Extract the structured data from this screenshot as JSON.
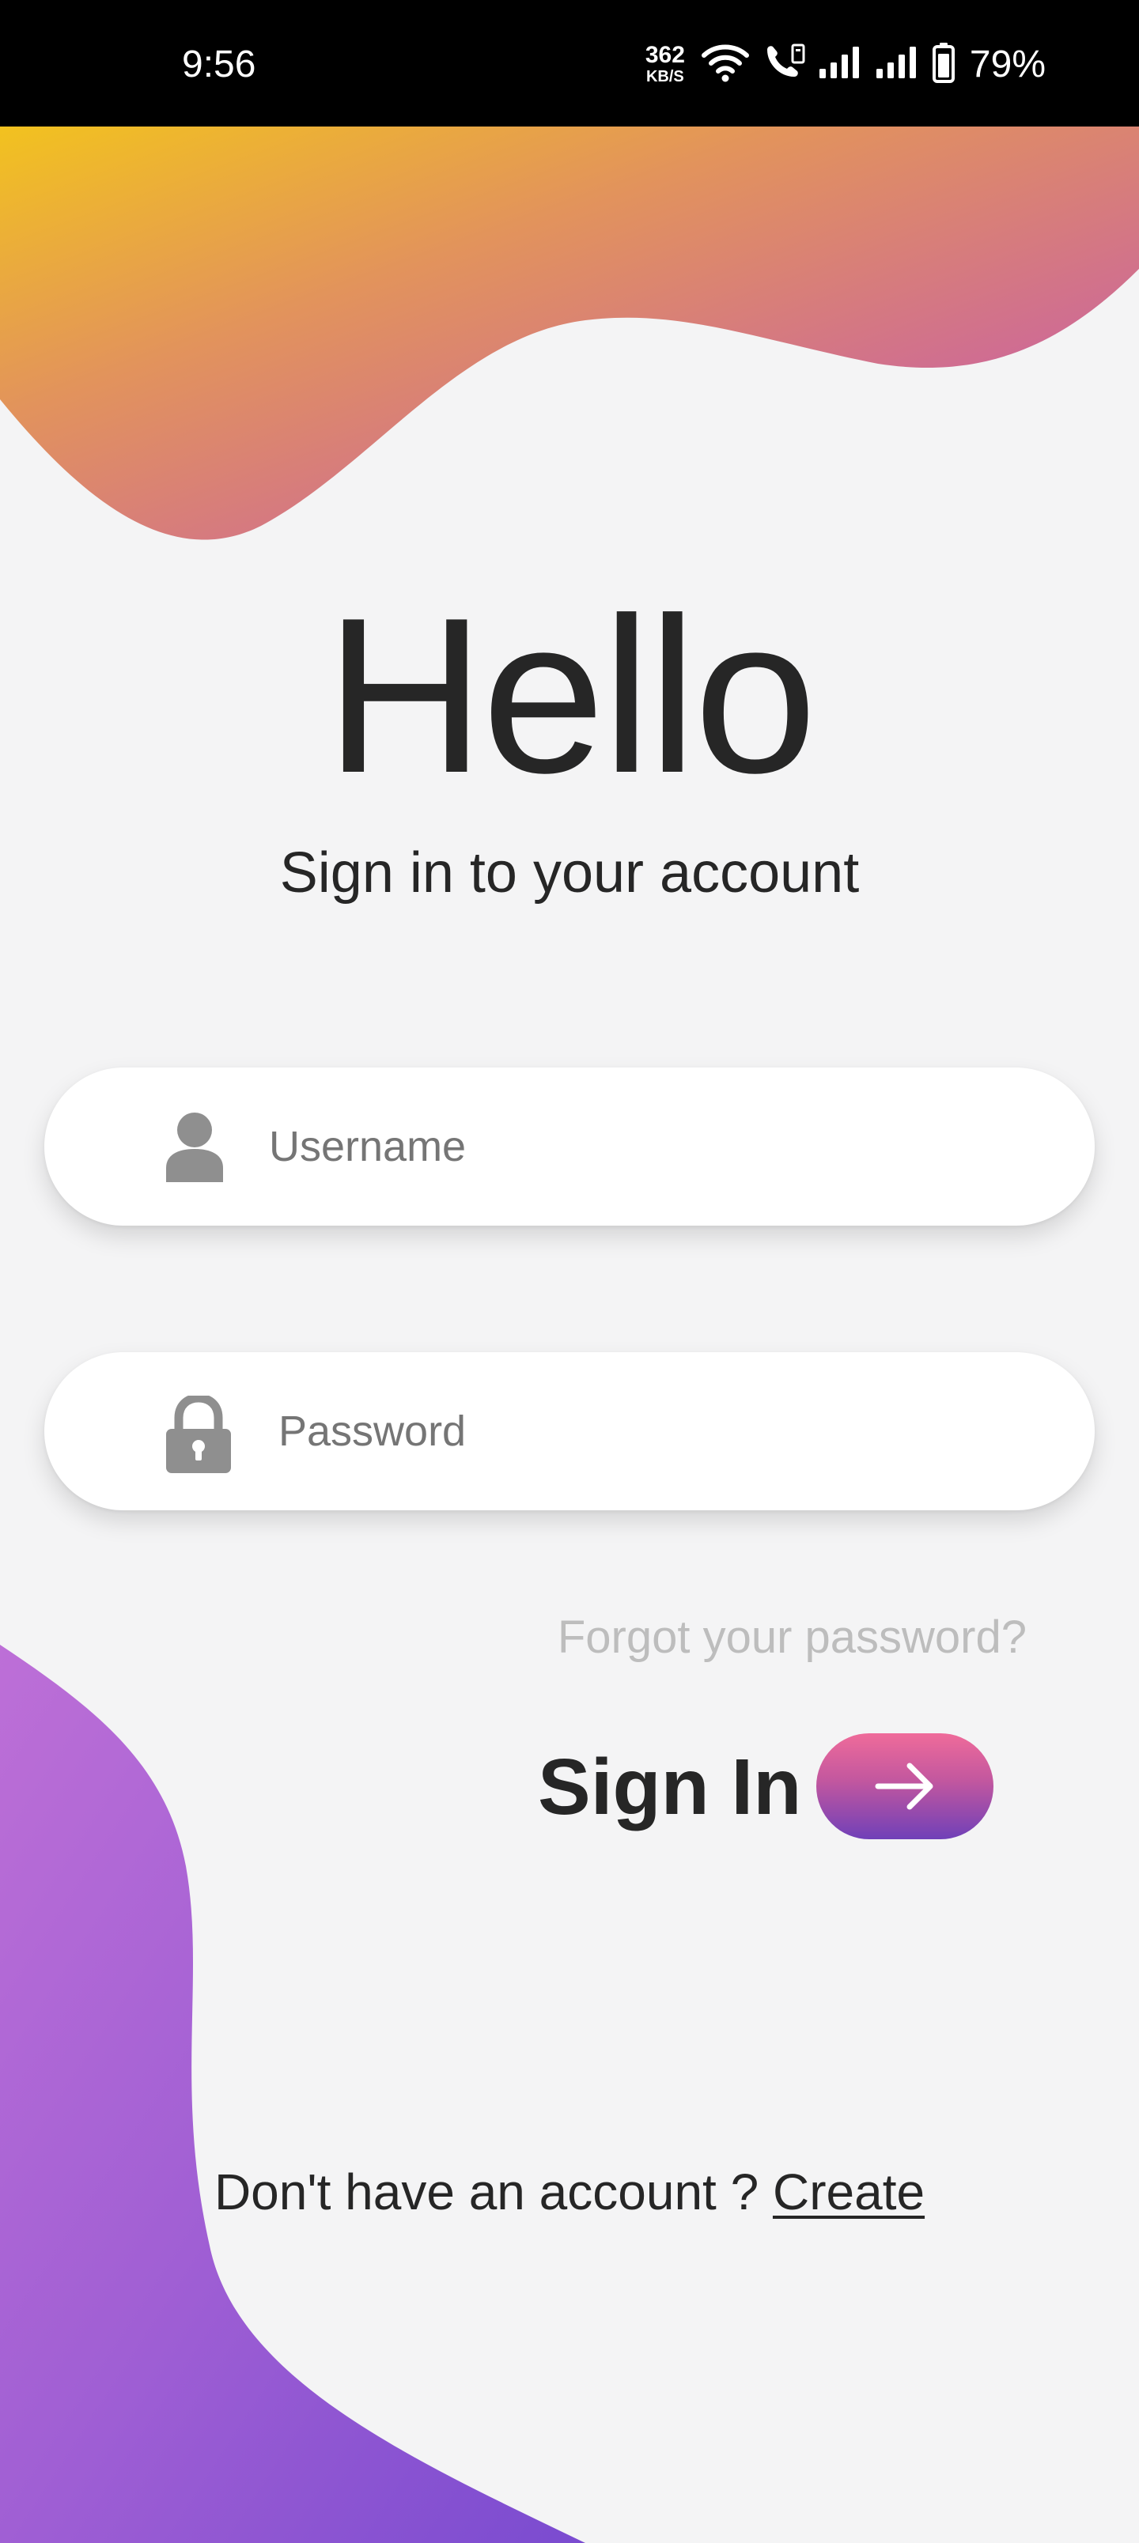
{
  "status_bar": {
    "time": "9:56",
    "net_speed_value": "362",
    "net_speed_unit": "KB/S",
    "battery": "79%",
    "icons": [
      "wifi-icon",
      "volte-call-icon",
      "signal-1-icon",
      "signal-2-icon",
      "battery-icon"
    ]
  },
  "header": {
    "title": "Hello",
    "subtitle": "Sign in to your account"
  },
  "form": {
    "username": {
      "placeholder": "Username",
      "value": "",
      "icon": "user-icon"
    },
    "password": {
      "placeholder": "Password",
      "value": "",
      "icon": "lock-icon"
    },
    "forgot_label": "Forgot your password?",
    "signin_label": "Sign In",
    "signin_icon": "arrow-right-icon"
  },
  "footer": {
    "prompt": "Don't have an account ? ",
    "create_label": "Create"
  },
  "colors": {
    "background": "#f4f4f5",
    "text_primary": "#262626",
    "placeholder": "#757575",
    "forgot_link": "#bdbdbd",
    "top_gradient": [
      "#f2c21f",
      "#e0905f",
      "#c346c0"
    ],
    "bottom_gradient": [
      "#bb6fd8",
      "#7a4bd0"
    ],
    "button_gradient": [
      "#ef6b9a",
      "#7040b8"
    ]
  }
}
